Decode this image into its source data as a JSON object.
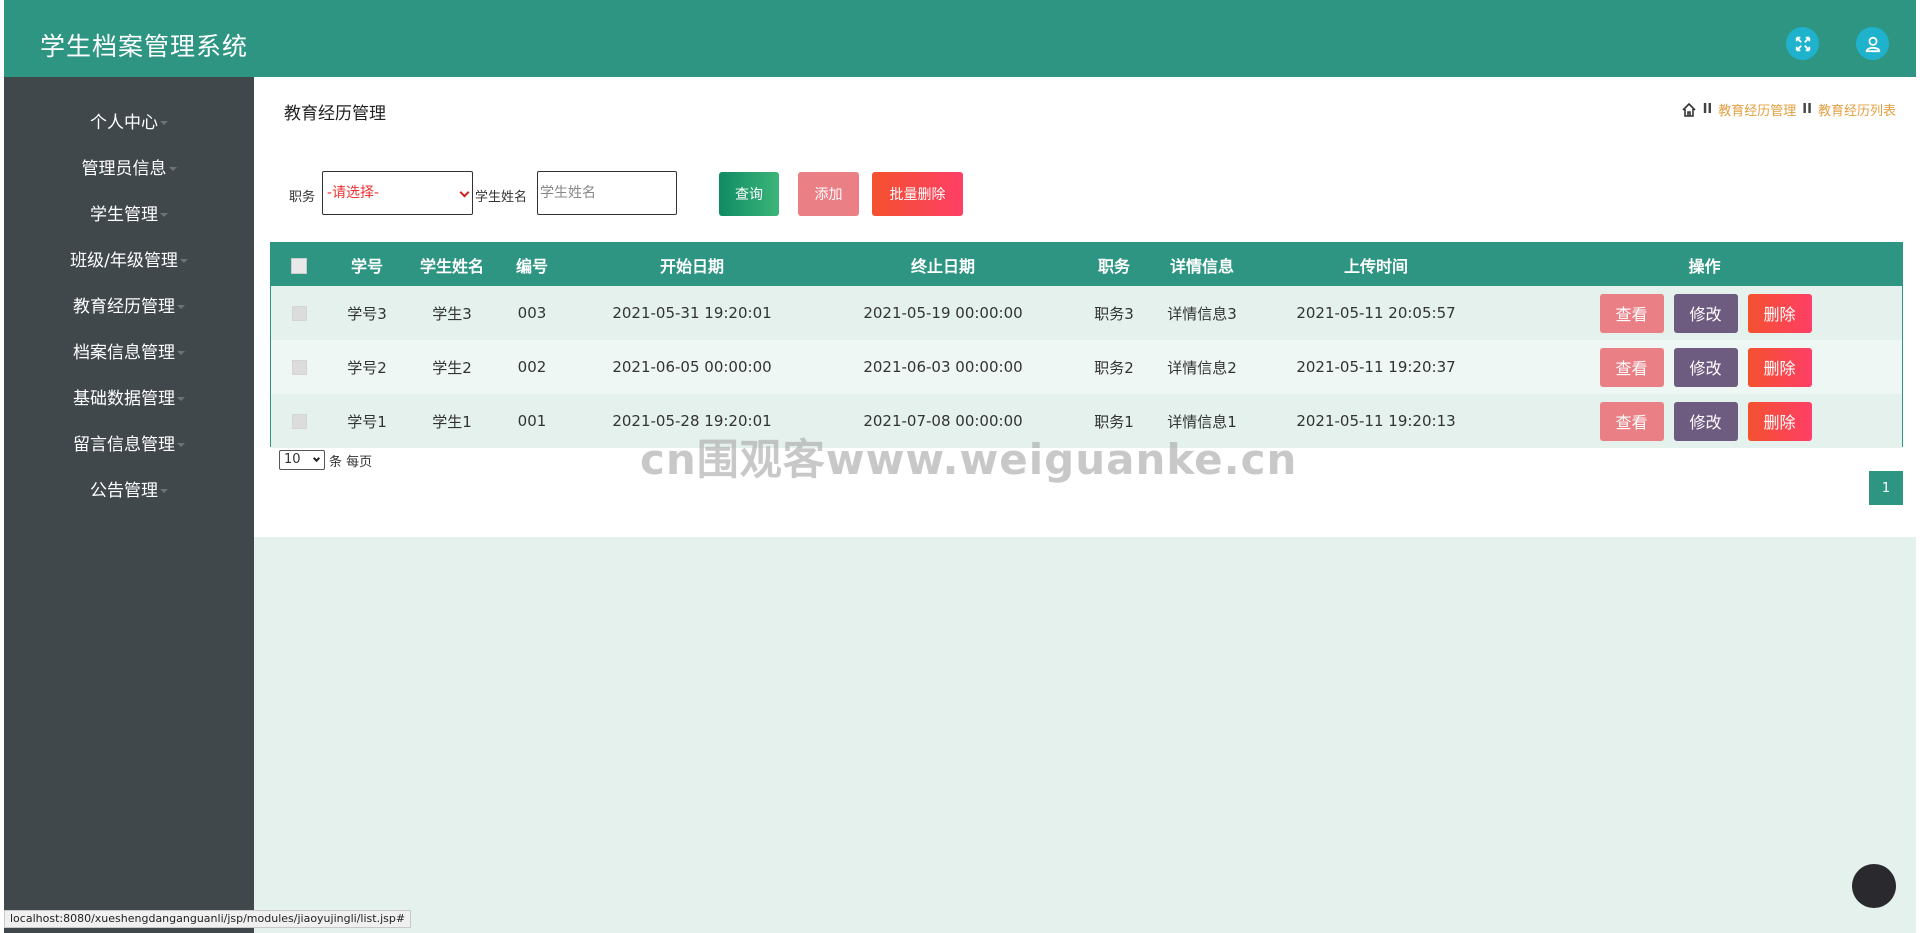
{
  "header": {
    "app_title": "学生档案管理系统",
    "fullscreen_icon": "fullscreen-icon",
    "user_icon": "user-icon",
    "accent_color": "#2e9582"
  },
  "sidebar": {
    "items": [
      {
        "label": "个人中心"
      },
      {
        "label": "管理员信息"
      },
      {
        "label": "学生管理"
      },
      {
        "label": "班级/年级管理"
      },
      {
        "label": "教育经历管理"
      },
      {
        "label": "档案信息管理"
      },
      {
        "label": "基础数据管理"
      },
      {
        "label": "留言信息管理"
      },
      {
        "label": "公告管理"
      }
    ]
  },
  "main": {
    "page_title": "教育经历管理",
    "breadcrumb": {
      "home_icon": "home-icon",
      "separator": "II",
      "items": [
        "教育经历管理",
        "教育经历列表"
      ]
    },
    "search": {
      "position_label": "职务",
      "position_selected": "-请选择-",
      "name_label": "学生姓名",
      "name_placeholder": "学生姓名",
      "query_button": "查询",
      "add_button": "添加",
      "batch_delete_button": "批量删除"
    },
    "table": {
      "columns": [
        "学号",
        "学生姓名",
        "编号",
        "开始日期",
        "终止日期",
        "职务",
        "详情信息",
        "上传时间",
        "操作"
      ],
      "rows": [
        {
          "student_no": "学号3",
          "student_name": "学生3",
          "code": "003",
          "start": "2021-05-31 19:20:01",
          "end": "2021-05-19 00:00:00",
          "position": "职务3",
          "detail": "详情信息3",
          "uploaded": "2021-05-11 20:05:57"
        },
        {
          "student_no": "学号2",
          "student_name": "学生2",
          "code": "002",
          "start": "2021-06-05 00:00:00",
          "end": "2021-06-03 00:00:00",
          "position": "职务2",
          "detail": "详情信息2",
          "uploaded": "2021-05-11 19:20:37"
        },
        {
          "student_no": "学号1",
          "student_name": "学生1",
          "code": "001",
          "start": "2021-05-28 19:20:01",
          "end": "2021-07-08 00:00:00",
          "position": "职务1",
          "detail": "详情信息1",
          "uploaded": "2021-05-11 19:20:13"
        }
      ],
      "actions": {
        "view": "查看",
        "edit": "修改",
        "delete": "删除"
      }
    },
    "pagination": {
      "page_size": "10",
      "page_size_suffix": "条 每页",
      "current_page": "1"
    }
  },
  "status_bar": {
    "url": "localhost:8080/xueshengdanganguanli/jsp/modules/jiaoyujingli/list.jsp#"
  },
  "watermark": "cn围观客www.weiguanke.cn"
}
